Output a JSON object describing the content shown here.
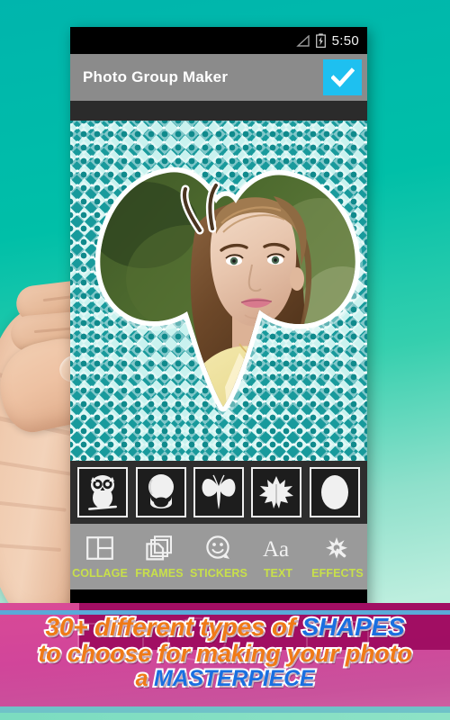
{
  "background": {
    "gradient_from": "#00b5ad",
    "gradient_to": "#a8e8d4"
  },
  "phone": {
    "statusbar": {
      "time": "5:50",
      "signal_icon": "signal-triangle-icon",
      "battery_icon": "battery-charging-icon"
    },
    "actionbar": {
      "title": "Photo Group Maker",
      "done_icon": "check-icon",
      "done_color": "#1ec0f0"
    },
    "canvas": {
      "pattern_color": "#189a9c",
      "shape_mask": "butterfly",
      "photo_description": "portrait-photo"
    },
    "shape_strip": {
      "items": [
        {
          "name": "owl",
          "icon": "owl-shape-icon"
        },
        {
          "name": "keyhole",
          "icon": "keyhole-shape-icon"
        },
        {
          "name": "butterfly",
          "icon": "butterfly-shape-icon"
        },
        {
          "name": "leaf",
          "icon": "leaf-shape-icon"
        },
        {
          "name": "oval",
          "icon": "oval-shape-icon"
        }
      ]
    },
    "tabbar": {
      "label_color": "#c8e04a",
      "tabs": [
        {
          "label": "COLLAGE",
          "icon": "collage-grid-icon"
        },
        {
          "label": "FRAMES",
          "icon": "frames-stack-icon"
        },
        {
          "label": "STICKERS",
          "icon": "smiley-bubble-icon"
        },
        {
          "label": "TEXT",
          "icon": "text-aa-icon"
        },
        {
          "label": "EFFECTS",
          "icon": "magic-wand-icon"
        }
      ]
    }
  },
  "banner": {
    "line1_a": "30+ different types of ",
    "line1_b": "SHAPES",
    "line2": "to choose for making your photo",
    "line3_a": "a ",
    "line3_b": "MASTERPIECE",
    "text_color": "#f07a17",
    "highlight_color": "#1a6fe0",
    "background_color": "#d1459a"
  }
}
